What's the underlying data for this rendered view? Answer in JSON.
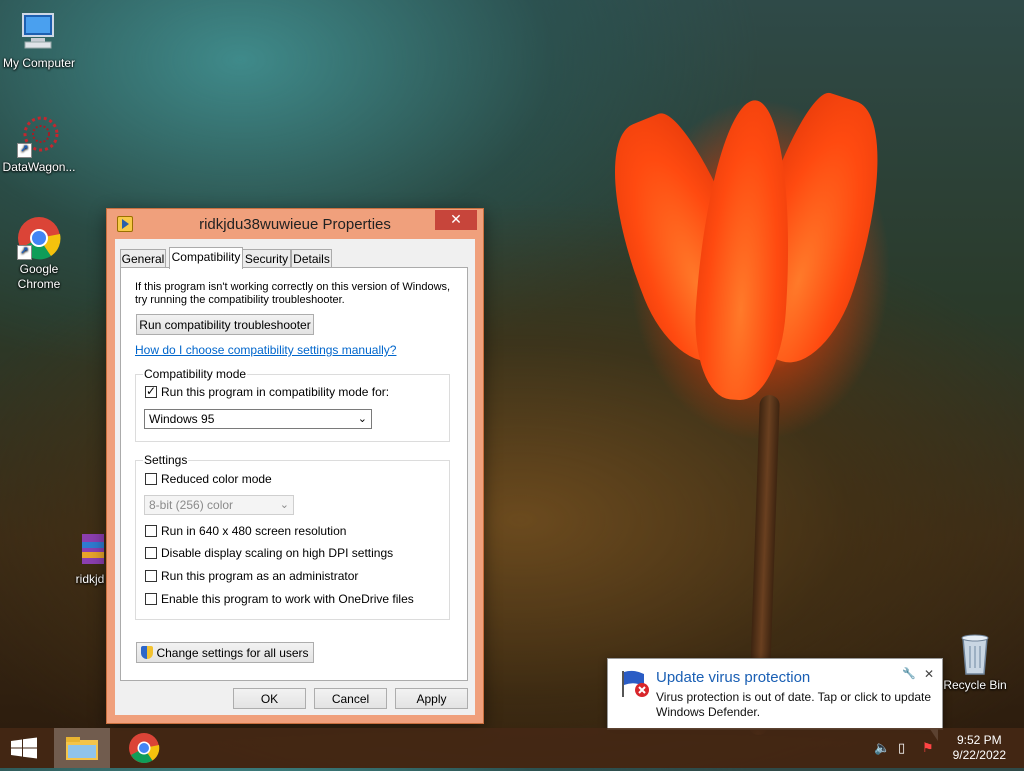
{
  "desktop": {
    "icons": [
      {
        "label": "My Computer"
      },
      {
        "label": "DataWagon..."
      },
      {
        "label": "Google Chrome"
      },
      {
        "label": "ridkjd"
      },
      {
        "label": "Recycle Bin"
      }
    ]
  },
  "dialog": {
    "title": "ridkjdu38wuwieue Properties",
    "close_glyph": "✕",
    "tabs": [
      "General",
      "Compatibility",
      "Security",
      "Details"
    ],
    "active_tab": "Compatibility",
    "intro_line1": "If this program isn't working correctly on this version of Windows,",
    "intro_line2": "try running the compatibility troubleshooter.",
    "troubleshooter_button": "Run compatibility troubleshooter",
    "manual_link": "How do I choose compatibility settings manually?",
    "compat_group": {
      "legend": "Compatibility mode",
      "checkbox_label": "Run this program in compatibility mode for:",
      "checked": true,
      "selected_os": "Windows 95"
    },
    "settings_group": {
      "legend": "Settings",
      "reduced_color": {
        "label": "Reduced color mode",
        "checked": false
      },
      "color_select": "8-bit (256) color",
      "res_640": {
        "label": "Run in 640 x 480 screen resolution",
        "checked": false
      },
      "dpi": {
        "label": "Disable display scaling on high DPI settings",
        "checked": false
      },
      "admin": {
        "label": "Run this program as an administrator",
        "checked": false
      },
      "onedrive": {
        "label": "Enable this program to work with OneDrive files",
        "checked": false
      }
    },
    "change_all_button": "Change settings for all users",
    "ok": "OK",
    "cancel": "Cancel",
    "apply": "Apply"
  },
  "notification": {
    "title": "Update virus protection",
    "body": "Virus protection is out of date. Tap or click to update Windows Defender.",
    "close_glyph": "✕"
  },
  "taskbar": {
    "time": "9:52 PM",
    "date": "9/22/2022"
  },
  "colors": {
    "dialog_frame": "#f0a07c",
    "close_button": "#c7453b",
    "link": "#0066cc",
    "taskbar": "#46281499"
  }
}
